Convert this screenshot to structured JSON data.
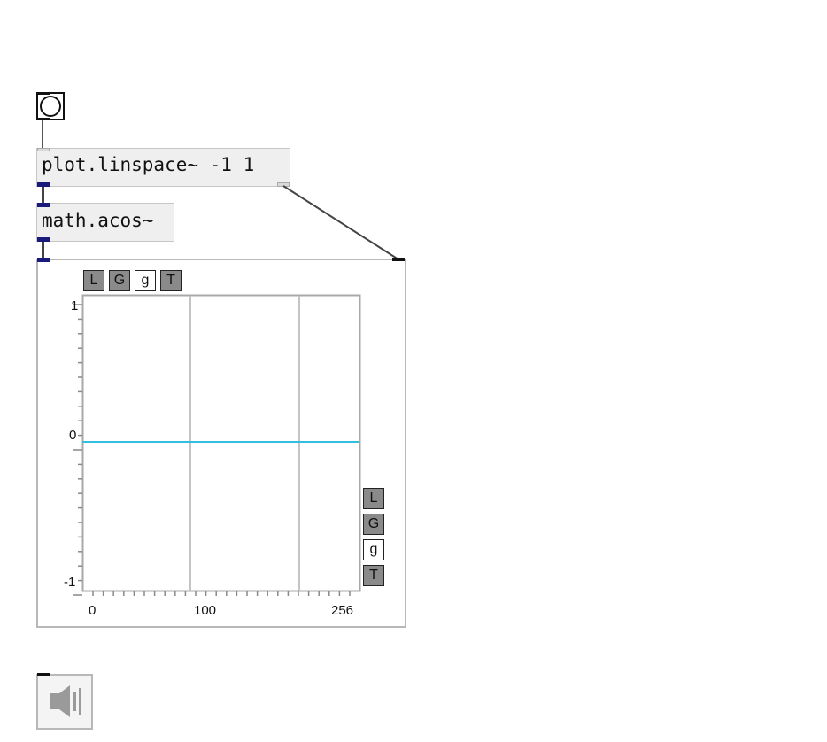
{
  "patch": {
    "bang": {
      "icon": "bang-circle-icon"
    },
    "obj_linspace": {
      "text": "plot.linspace~ -1 1"
    },
    "obj_acos": {
      "text": "math.acos~"
    },
    "plot": {
      "x_toolbar": [
        "L",
        "G",
        "g",
        "T"
      ],
      "y_toolbar": [
        "L",
        "G",
        "g",
        "T"
      ],
      "y_ticks": [
        "1",
        "0",
        "-1"
      ],
      "x_ticks": [
        "0",
        "100",
        "256"
      ],
      "line_color": "#33bde0"
    },
    "dac": {
      "icon": "speaker-icon"
    }
  }
}
